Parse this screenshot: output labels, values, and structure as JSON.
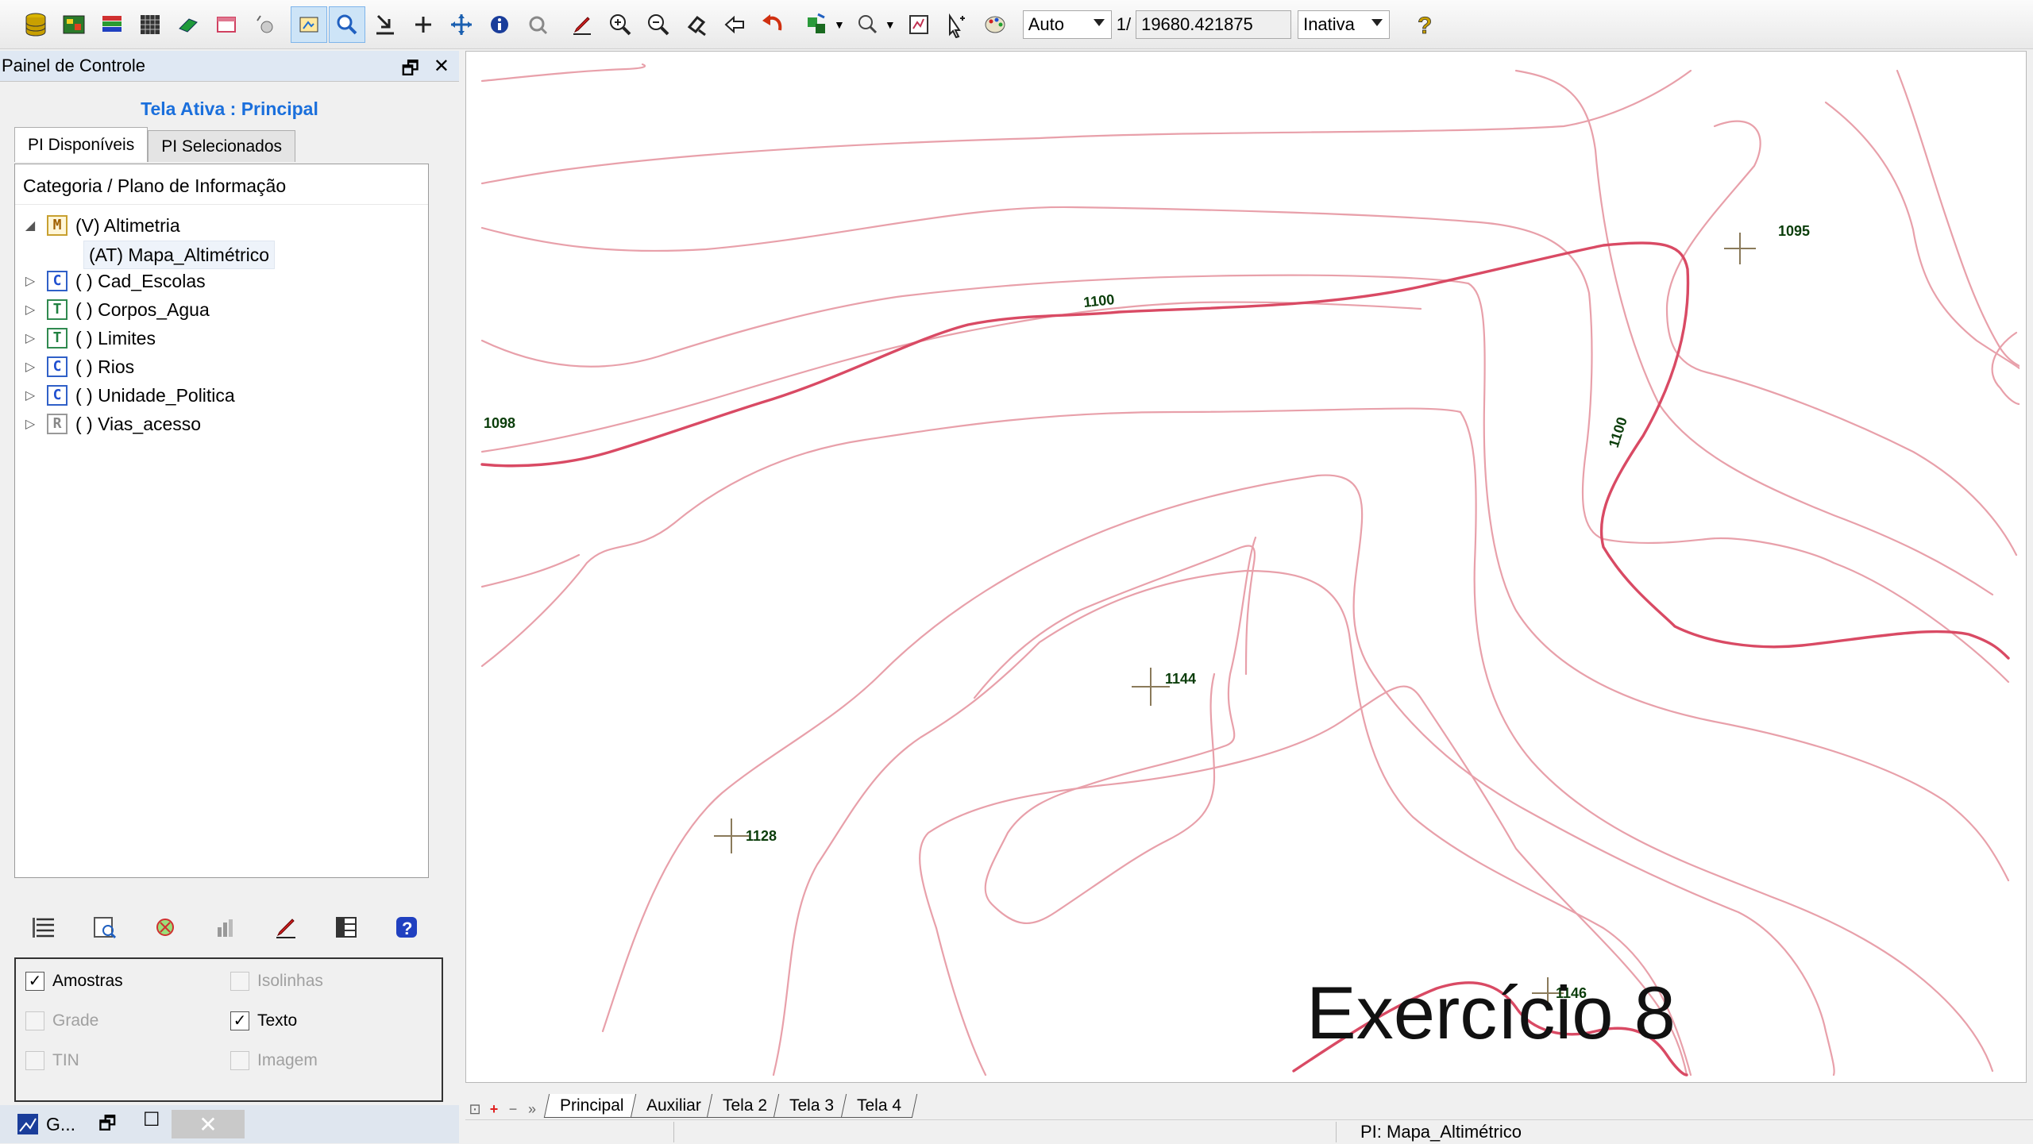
{
  "toolbar": {
    "scale_mode": "Auto",
    "scale_prefix": "1/",
    "scale_value": "19680.421875",
    "status_select": "Inativa",
    "icons": [
      "database-icon",
      "layers-icon",
      "stack-icon",
      "grid-icon",
      "eraser-icon",
      "window-icon",
      "mouse-icon",
      "select-icon",
      "zoom-area-icon",
      "import-icon",
      "add-point-icon",
      "pan-icon",
      "info-icon",
      "query-icon",
      "edit-icon",
      "zoom-in-icon",
      "zoom-out-icon",
      "zoom-window-icon",
      "back-icon",
      "undo-icon",
      "draw-icon",
      "magnify-icon",
      "map-window-icon",
      "cursor-icon",
      "palette-icon",
      "help-icon"
    ]
  },
  "panel": {
    "title": "Painel de Controle",
    "active_screen": "Tela Ativa : Principal",
    "tabs": [
      "PI Disponíveis",
      "PI Selecionados"
    ],
    "tree_header": "Categoria / Plano de Informação",
    "categories": [
      {
        "box": "M",
        "label": "(V) Altimetria",
        "expanded": true,
        "child": "(AT) Mapa_Altimétrico"
      },
      {
        "box": "C",
        "label": "( ) Cad_Escolas"
      },
      {
        "box": "T",
        "label": "( ) Corpos_Agua"
      },
      {
        "box": "T",
        "label": "( ) Limites"
      },
      {
        "box": "C",
        "label": "( ) Rios"
      },
      {
        "box": "C",
        "label": "( ) Unidade_Politica"
      },
      {
        "box": "R",
        "label": "( ) Vias_acesso"
      }
    ],
    "options": [
      {
        "label": "Amostras",
        "checked": true,
        "enabled": true
      },
      {
        "label": "Isolinhas",
        "checked": false,
        "enabled": false
      },
      {
        "label": "Grade",
        "checked": false,
        "enabled": false
      },
      {
        "label": "Texto",
        "checked": true,
        "enabled": true
      },
      {
        "label": "TIN",
        "checked": false,
        "enabled": false
      },
      {
        "label": "Imagem",
        "checked": false,
        "enabled": false
      }
    ]
  },
  "map": {
    "labels": {
      "c1098": "1098",
      "c1100a": "1100",
      "c1100b": "1100",
      "p1095": "1095",
      "p1144": "1144",
      "p1128": "1128",
      "p1146": "1146"
    },
    "colors": {
      "contour": "#e8a0aa",
      "index_contour": "#d94a64",
      "label": "#0a3d0a"
    }
  },
  "overlay_title": "Exercício 8",
  "screen_tabs": [
    "Principal",
    "Auxiliar",
    "Tela 2",
    "Tela 3",
    "Tela 4"
  ],
  "taskbar": {
    "label": "G..."
  },
  "status": {
    "pi": "PI: Mapa_Altimétrico"
  }
}
